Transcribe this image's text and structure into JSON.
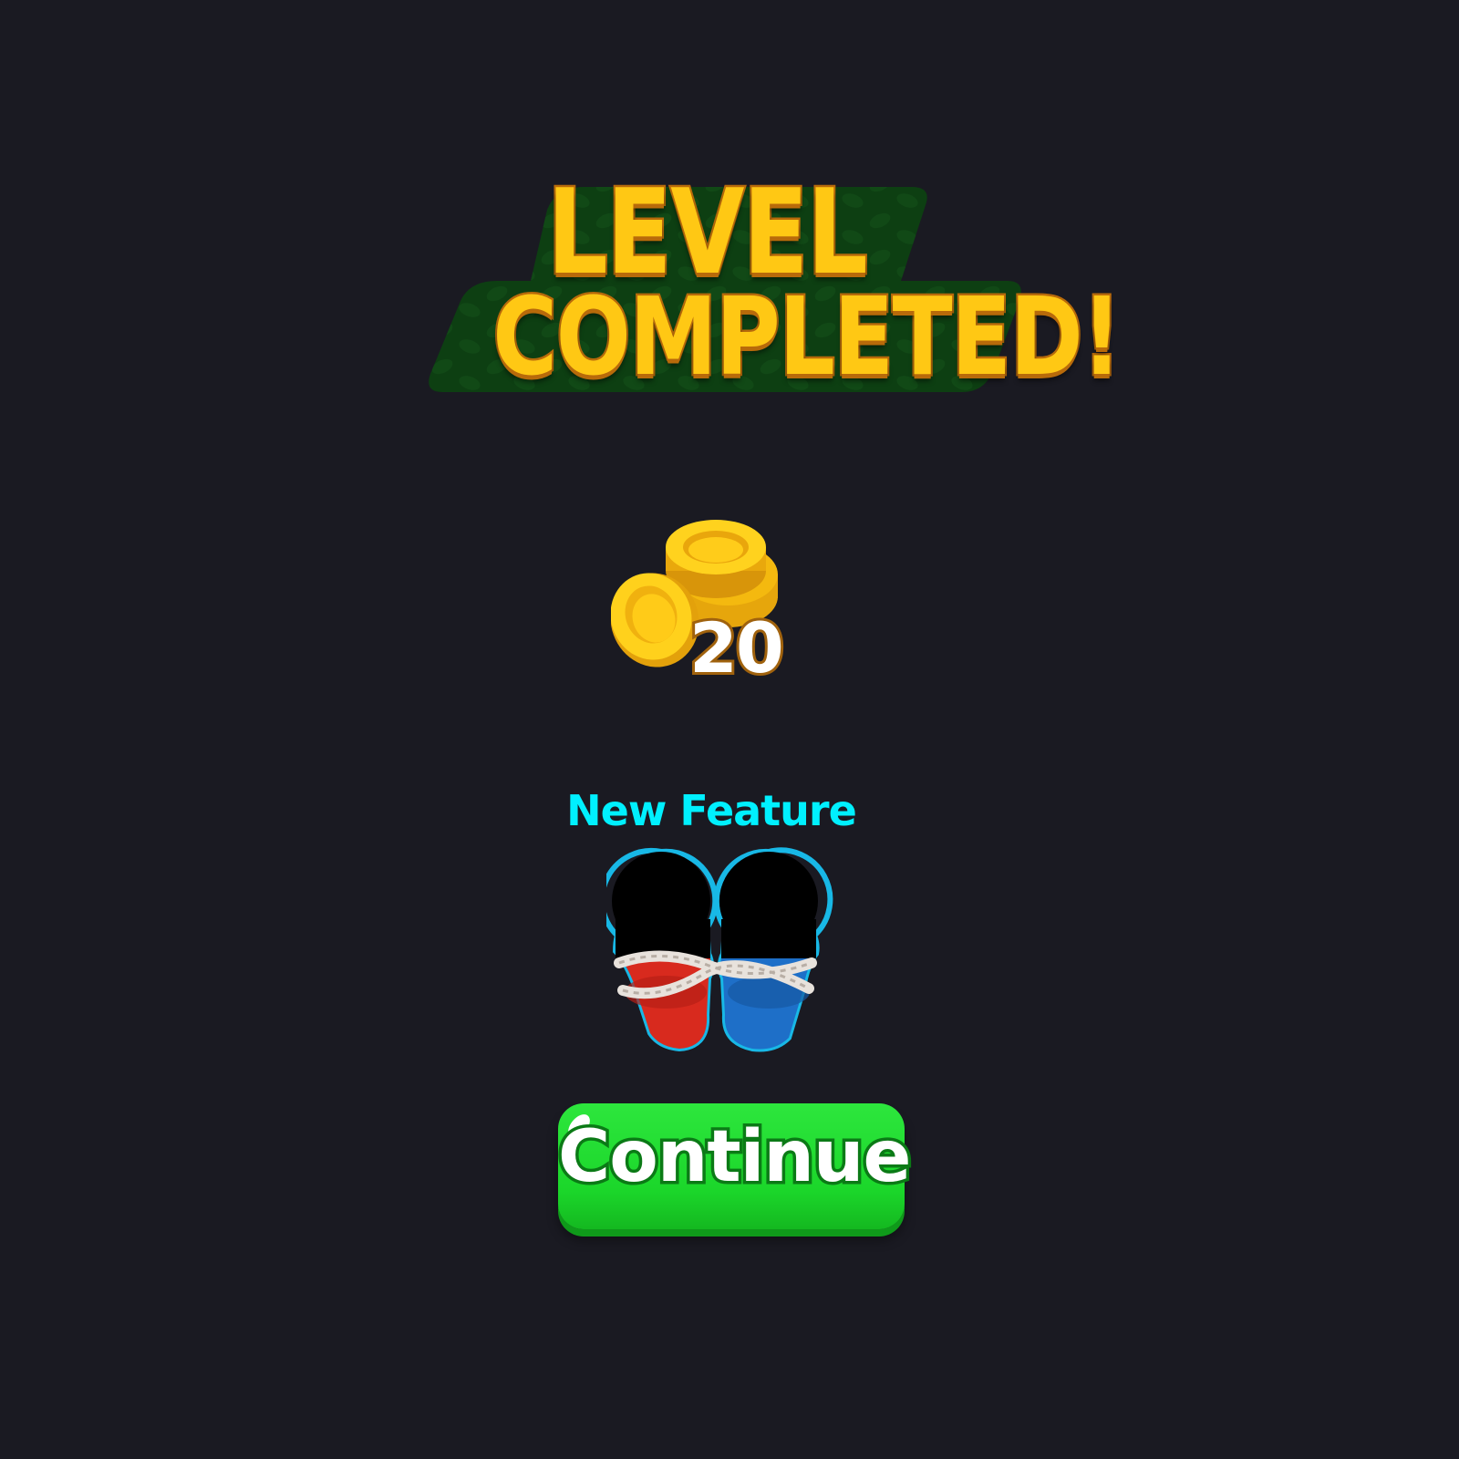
{
  "title": {
    "line1": "LEVEL",
    "line2": "COMPLETED!"
  },
  "reward": {
    "icon": "coin-stack-icon",
    "amount": "20"
  },
  "feature": {
    "label": "New Feature",
    "icon": "tied-pawns-silhouette-icon"
  },
  "continue_button": {
    "label": "Continue"
  },
  "colors": {
    "background": "#1a1a22",
    "title_yellow": "#ffc814",
    "banner_green": "#0d3f12",
    "feature_cyan": "#00f0ff",
    "button_green": "#1bd62a",
    "pawn_red": "#d82a1e",
    "pawn_blue": "#1e6fc8"
  }
}
